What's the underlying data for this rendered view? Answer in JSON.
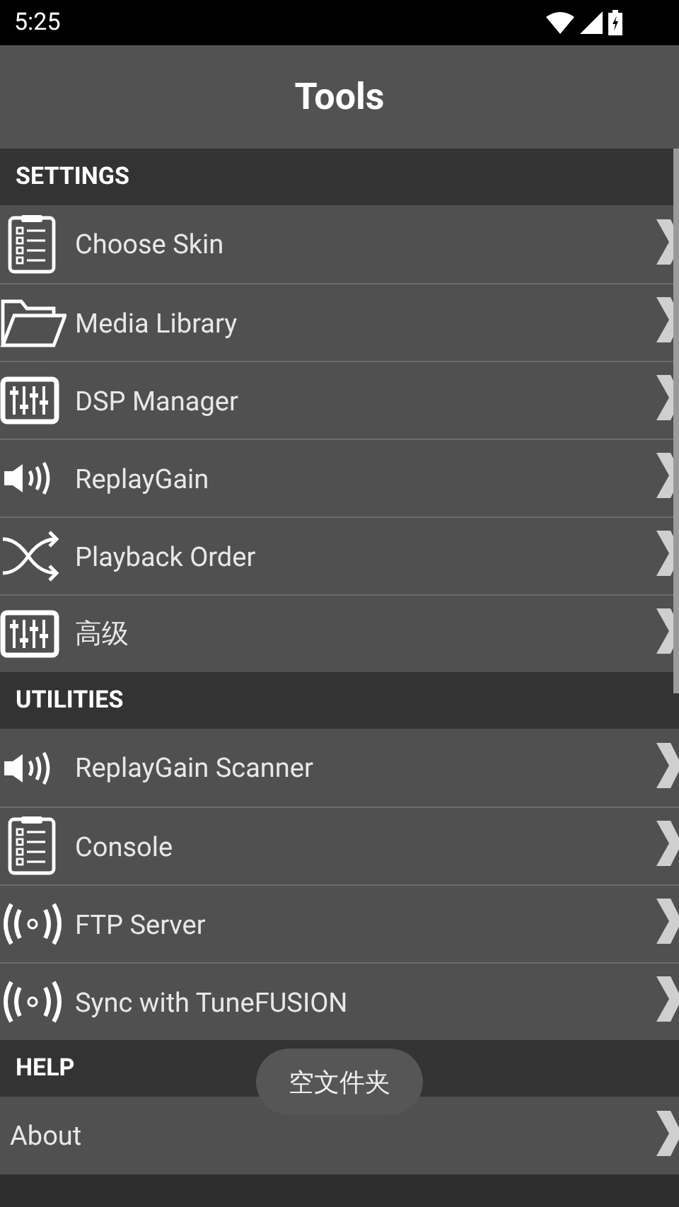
{
  "status_bar": {
    "time": "5:25"
  },
  "header": {
    "title": "Tools"
  },
  "sections": [
    {
      "title": "SETTINGS",
      "items": [
        {
          "label": "Choose Skin",
          "kind": "clipboard"
        },
        {
          "label": "Media Library",
          "kind": "folder"
        },
        {
          "label": "DSP Manager",
          "kind": "sliders"
        },
        {
          "label": "ReplayGain",
          "kind": "speaker"
        },
        {
          "label": "Playback Order",
          "kind": "shuffle"
        },
        {
          "label": "高级",
          "kind": "sliders"
        }
      ]
    },
    {
      "title": "UTILITIES",
      "items": [
        {
          "label": "ReplayGain Scanner",
          "kind": "speaker"
        },
        {
          "label": "Console",
          "kind": "clipboard"
        },
        {
          "label": "FTP Server",
          "kind": "broadcast"
        },
        {
          "label": "Sync with TuneFUSION",
          "kind": "broadcast"
        }
      ]
    },
    {
      "title": "HELP",
      "items": [
        {
          "label": "About",
          "kind": "plain"
        }
      ]
    }
  ],
  "toast": {
    "text": "空文件夹"
  }
}
